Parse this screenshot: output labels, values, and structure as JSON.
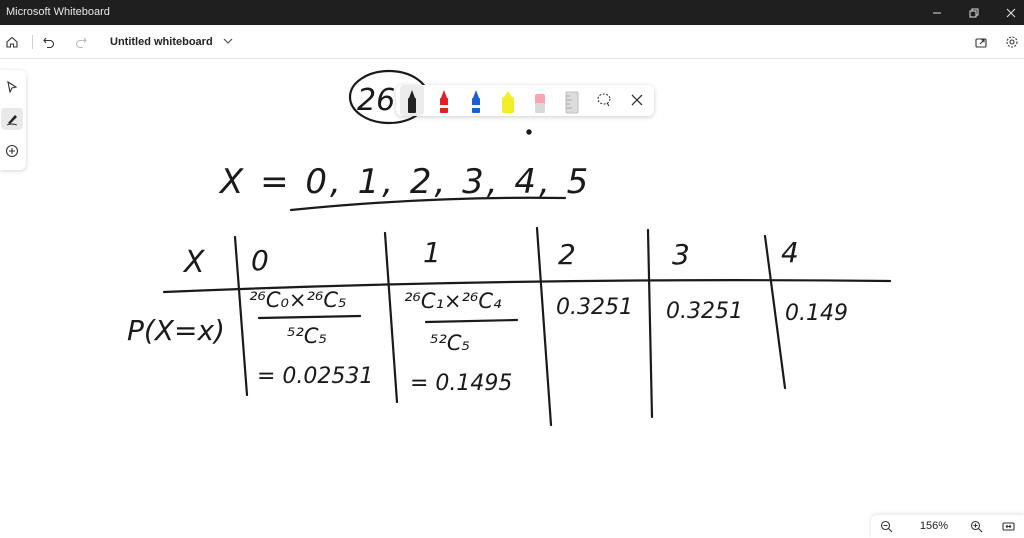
{
  "app": {
    "title": "Microsoft Whiteboard"
  },
  "toolbar": {
    "doc_title": "Untitled whiteboard"
  },
  "zoom": {
    "level": "156%"
  },
  "board": {
    "fragment": "26",
    "x_values": "X = 0, 1, 2, 3, 4, 5",
    "table": {
      "header_label": "X",
      "row_label": "P(X=x)",
      "columns": [
        "0",
        "1",
        "2",
        "3",
        "4"
      ],
      "col0_expr_num": "²⁶C₀×²⁶C₅",
      "col0_expr_den": "⁵²C₅",
      "col0_result": "= 0.02531",
      "col1_expr_num": "²⁶C₁×²⁶C₄",
      "col1_expr_den": "⁵²C₅",
      "col1_result": "= 0.1495",
      "col2_value": "0.3251",
      "col3_value": "0.3251",
      "col4_value": "0.149"
    }
  },
  "colors": {
    "titlebar": "#1f1f1f",
    "ink": "#1a1a1a",
    "pen_black": "#1a1a1a",
    "pen_red": "#e0202a",
    "pen_blue": "#1e5fd0",
    "highlighter_yellow": "#f2ee2a",
    "eraser_pink": "#f4a7ae"
  }
}
